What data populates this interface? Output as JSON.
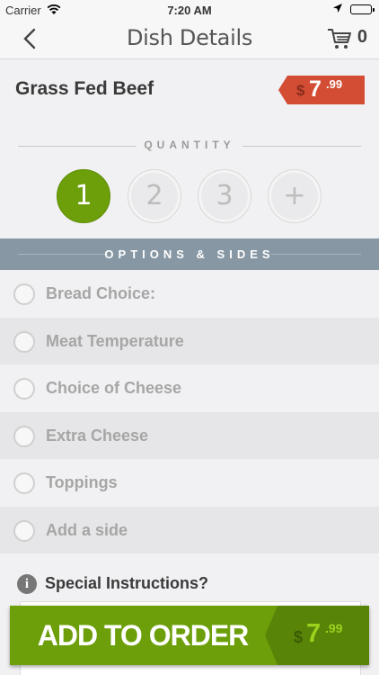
{
  "status_bar": {
    "carrier": "Carrier",
    "time": "7:20 AM"
  },
  "nav": {
    "title": "Dish Details",
    "back_icon": "chevron-left-icon",
    "cart_icon": "cart-icon",
    "cart_count": "0"
  },
  "dish": {
    "name": "Grass Fed Beef",
    "price": {
      "currency": "$",
      "dollars": "7",
      "cents": ".99"
    },
    "accent_color": "#d34d35"
  },
  "quantity": {
    "label": "QUANTITY",
    "options": [
      "1",
      "2",
      "3",
      "+"
    ],
    "selected": "1",
    "selected_color": "#6c9f0a"
  },
  "options": {
    "header": "OPTIONS & SIDES",
    "header_color": "#8797a3",
    "items": [
      {
        "label": "Bread Choice:"
      },
      {
        "label": "Meat Temperature"
      },
      {
        "label": "Choice of Cheese"
      },
      {
        "label": "Extra Cheese"
      },
      {
        "label": "Toppings"
      },
      {
        "label": "Add a side"
      }
    ]
  },
  "special": {
    "label": "Special Instructions?",
    "info_icon": "info-icon"
  },
  "add_to_order": {
    "label": "ADD TO ORDER",
    "price": {
      "currency": "$",
      "dollars": "7",
      "cents": ".99"
    },
    "button_color": "#6c9f0a"
  }
}
